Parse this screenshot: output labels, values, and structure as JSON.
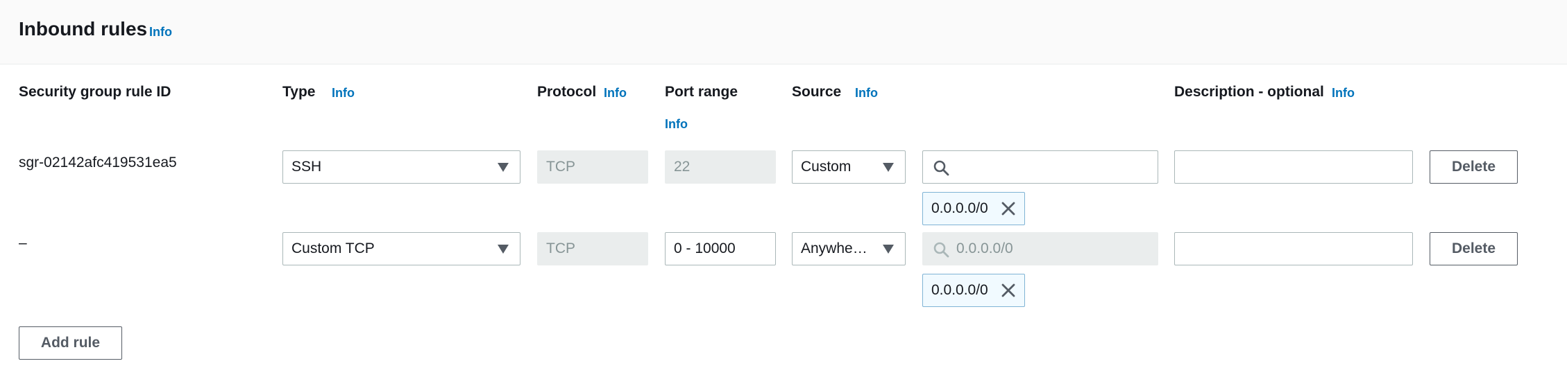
{
  "header": {
    "title": "Inbound rules",
    "info": "Info"
  },
  "columns": {
    "rule_id": "Security group rule ID",
    "type": "Type",
    "type_info": "Info",
    "protocol": "Protocol",
    "protocol_info": "Info",
    "port_range": "Port range",
    "port_range_info": "Info",
    "source": "Source",
    "source_info": "Info",
    "description": "Description - optional",
    "description_info": "Info"
  },
  "rows": [
    {
      "rule_id": "sgr-02142afc419531ea5",
      "type": "SSH",
      "protocol": "TCP",
      "port_range": "22",
      "source_type": "Custom",
      "source_search_placeholder": "",
      "source_token": "0.0.0.0/0",
      "description": "",
      "delete_label": "Delete"
    },
    {
      "rule_id": "–",
      "type": "Custom TCP",
      "protocol": "TCP",
      "port_range": "0 - 10000",
      "source_type": "Anywhe…",
      "source_search_placeholder": "0.0.0.0/0",
      "source_token": "0.0.0.0/0",
      "description": "",
      "delete_label": "Delete"
    }
  ],
  "add_rule_label": "Add rule",
  "icons": {
    "search": "search-icon",
    "dismiss": "close-icon",
    "dropdown": "caret-down-icon"
  },
  "colors": {
    "link": "#0073bb",
    "token_border": "#7fb3d5",
    "token_bg": "#f1faff",
    "disabled_bg": "#eaeded"
  }
}
